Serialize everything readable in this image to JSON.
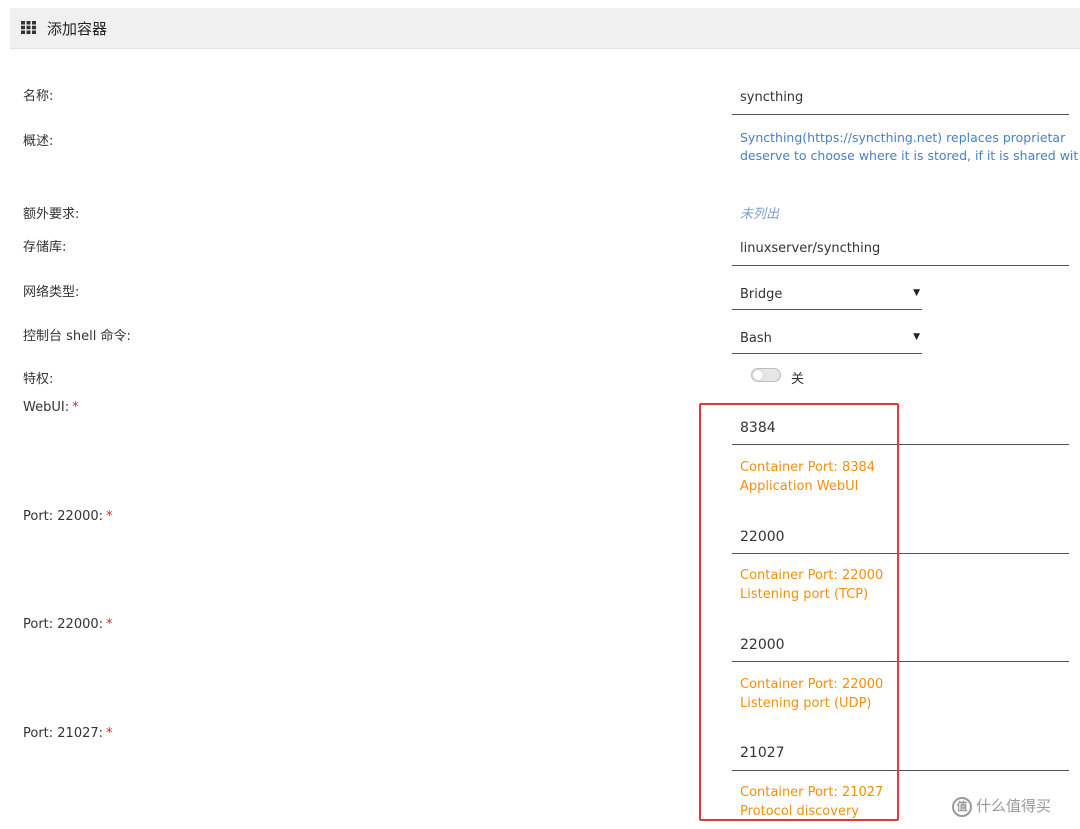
{
  "header": {
    "title": "添加容器",
    "icon": "grid-icon"
  },
  "form": {
    "required_mark": "*",
    "name": {
      "label": "名称:",
      "value": "syncthing"
    },
    "description": {
      "label": "概述:",
      "line1": "Syncthing(https://syncthing.net) replaces proprietar",
      "line2": "deserve to choose where it is stored, if it is shared wit"
    },
    "extra": {
      "label": "额外要求:",
      "value": "未列出"
    },
    "repository": {
      "label": "存储库:",
      "value": "linuxserver/syncthing"
    },
    "network": {
      "label": "网络类型:",
      "value": "Bridge"
    },
    "console": {
      "label": "控制台 shell 命令:",
      "value": "Bash"
    },
    "privileged": {
      "label": "特权:",
      "state": "关"
    }
  },
  "ports": [
    {
      "label": "WebUI:",
      "value": "8384",
      "hint1": "Container Port: 8384",
      "hint2": "Application WebUI"
    },
    {
      "label": "Port: 22000:",
      "value": "22000",
      "hint1": "Container Port: 22000",
      "hint2": "Listening port (TCP)"
    },
    {
      "label": "Port: 22000:",
      "value": "22000",
      "hint1": "Container Port: 22000",
      "hint2": "Listening port (UDP)"
    },
    {
      "label": "Port: 21027:",
      "value": "21027",
      "hint1": "Container Port: 21027",
      "hint2": "Protocol discovery"
    }
  ],
  "colors": {
    "hint": "#f0900a",
    "link": "#4a7fc1",
    "required": "#e02020",
    "highlight": "#e03a3a"
  },
  "watermark": {
    "icon_text": "值",
    "text": "什么值得买"
  }
}
